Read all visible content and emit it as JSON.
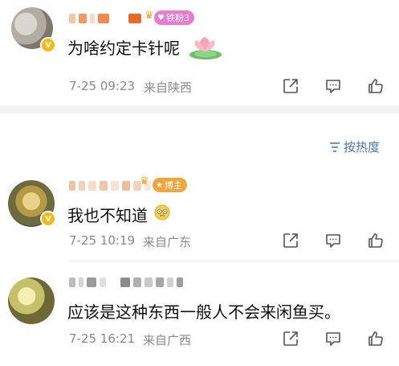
{
  "comments": [
    {
      "tag_label": "铁粉3",
      "text": "为啥约定卡针呢",
      "date": "7-25 09:23",
      "location": "来自陕西"
    },
    {
      "tag_label": "博主",
      "text": "我也不知道",
      "date": "7-25 10:19",
      "location": "来自广东"
    },
    {
      "text": "应该是这种东西一般人不会来闲鱼买。",
      "date": "7-25 16:21",
      "location": "来自广西"
    }
  ],
  "sort": {
    "label": "按热度"
  },
  "icons": {
    "share": "share-icon",
    "comment": "comment-icon",
    "like": "thumbs-up-icon"
  },
  "colors": {
    "link": "#4a76a8",
    "fan_tag": "#e87bd0",
    "host_tag": "#f1a53a",
    "verify": "#f5b814"
  }
}
